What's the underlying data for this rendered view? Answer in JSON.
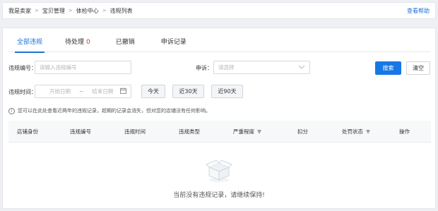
{
  "breadcrumb": {
    "items": [
      "我是卖家",
      "宝贝管理",
      "体检中心",
      "违规列表"
    ],
    "separator": ">"
  },
  "help_link": "查看帮助",
  "tabs": [
    {
      "label": "全部违规",
      "count": "",
      "active": true
    },
    {
      "label": "待处理",
      "count": "0",
      "active": false
    },
    {
      "label": "已撤销",
      "count": "",
      "active": false
    },
    {
      "label": "申诉记录",
      "count": "",
      "active": false
    }
  ],
  "filters": {
    "violation_no_label": "违规编号：",
    "violation_no_placeholder": "请输入违规编号",
    "appeal_label": "申诉：",
    "appeal_placeholder": "请选择",
    "time_label": "违规时间：",
    "start_placeholder": "开始日期",
    "range_sep": "~",
    "end_placeholder": "结束日期",
    "search_button": "搜索",
    "clear_button": "清空",
    "quick_today": "今天",
    "quick_30": "近30天",
    "quick_90": "近90天"
  },
  "info_text": "您可以在此处查看近两年的违规记录，超期的记录会消失，但对您的店铺没有任何影响。",
  "table": {
    "columns": [
      "店铺身份",
      "违规编号",
      "违规时间",
      "违规类型",
      "严重程度",
      "扣分",
      "处罚状态",
      "操作"
    ]
  },
  "empty_text": "当前没有违规记录，请继续保持!",
  "colors": {
    "primary": "#1677e6",
    "tab_active": "#1d72d6",
    "badge": "#e5312a"
  }
}
